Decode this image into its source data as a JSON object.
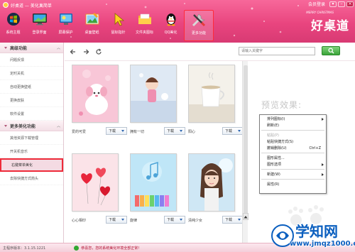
{
  "window": {
    "title": "好桌道 — 美化真简单",
    "member_label": "会员登录"
  },
  "toolbar": {
    "items": [
      {
        "label": "系统主题",
        "icon": "windows-logo-icon"
      },
      {
        "label": "登录界面",
        "icon": "monitor-icon"
      },
      {
        "label": "屏幕保护",
        "icon": "screensaver-icon"
      },
      {
        "label": "桌面壁纸",
        "icon": "wallpaper-icon"
      },
      {
        "label": "鼠标指针",
        "icon": "mouse-pointer-icon"
      },
      {
        "label": "文件夹图标",
        "icon": "folder-icon"
      },
      {
        "label": "QQ美化",
        "icon": "qq-penguin-icon"
      },
      {
        "label": "更多功能",
        "icon": "tools-icon"
      }
    ],
    "active_index": 7
  },
  "brand": {
    "text": "好桌道",
    "sub": "MERRY CHRISTMAS"
  },
  "sidebar": {
    "groups": [
      {
        "title": "高级功能",
        "items": [
          "问题反馈",
          "定时关机",
          "自动更换壁纸",
          "更换皮肤",
          "软件设置"
        ]
      },
      {
        "title": "更多美化功能",
        "items": [
          "其他资源下载管理",
          "开关机音乐",
          "右键菜单美化",
          "去除快捷方式箭头"
        ]
      }
    ],
    "active_item": "右键菜单美化"
  },
  "search": {
    "placeholder": "请输入关键字"
  },
  "gallery": {
    "download_label": "下载",
    "items": [
      {
        "name": "爱的可爱"
      },
      {
        "name": "拥有一切"
      },
      {
        "name": "阳心"
      },
      {
        "name": "心心相印"
      },
      {
        "name": "旋律"
      },
      {
        "name": "清纯少女"
      }
    ]
  },
  "preview": {
    "title": "预览效果:",
    "menu": [
      {
        "label": "排列图标(I)",
        "type": "submenu"
      },
      {
        "label": "刷新(E)",
        "type": "item"
      },
      {
        "type": "separator"
      },
      {
        "label": "粘贴(P)",
        "type": "disabled"
      },
      {
        "label": "粘贴快捷方式(S)",
        "type": "item"
      },
      {
        "label": "撤销删除(U)",
        "type": "item",
        "shortcut": "Ctrl+Z"
      },
      {
        "type": "separator"
      },
      {
        "label": "图形属性...",
        "type": "item"
      },
      {
        "label": "图形选项",
        "type": "submenu"
      },
      {
        "type": "separator"
      },
      {
        "label": "新建(W)",
        "type": "submenu"
      },
      {
        "type": "separator"
      },
      {
        "label": "属性(R)",
        "type": "item"
      }
    ]
  },
  "statusbar": {
    "version": "主程序版本：3.1.15.1221",
    "message": "恭喜您，您的系统美化环境全部正常!"
  },
  "site_watermark": {
    "title": "学知网",
    "url": "www.jmqz1000.com"
  }
}
